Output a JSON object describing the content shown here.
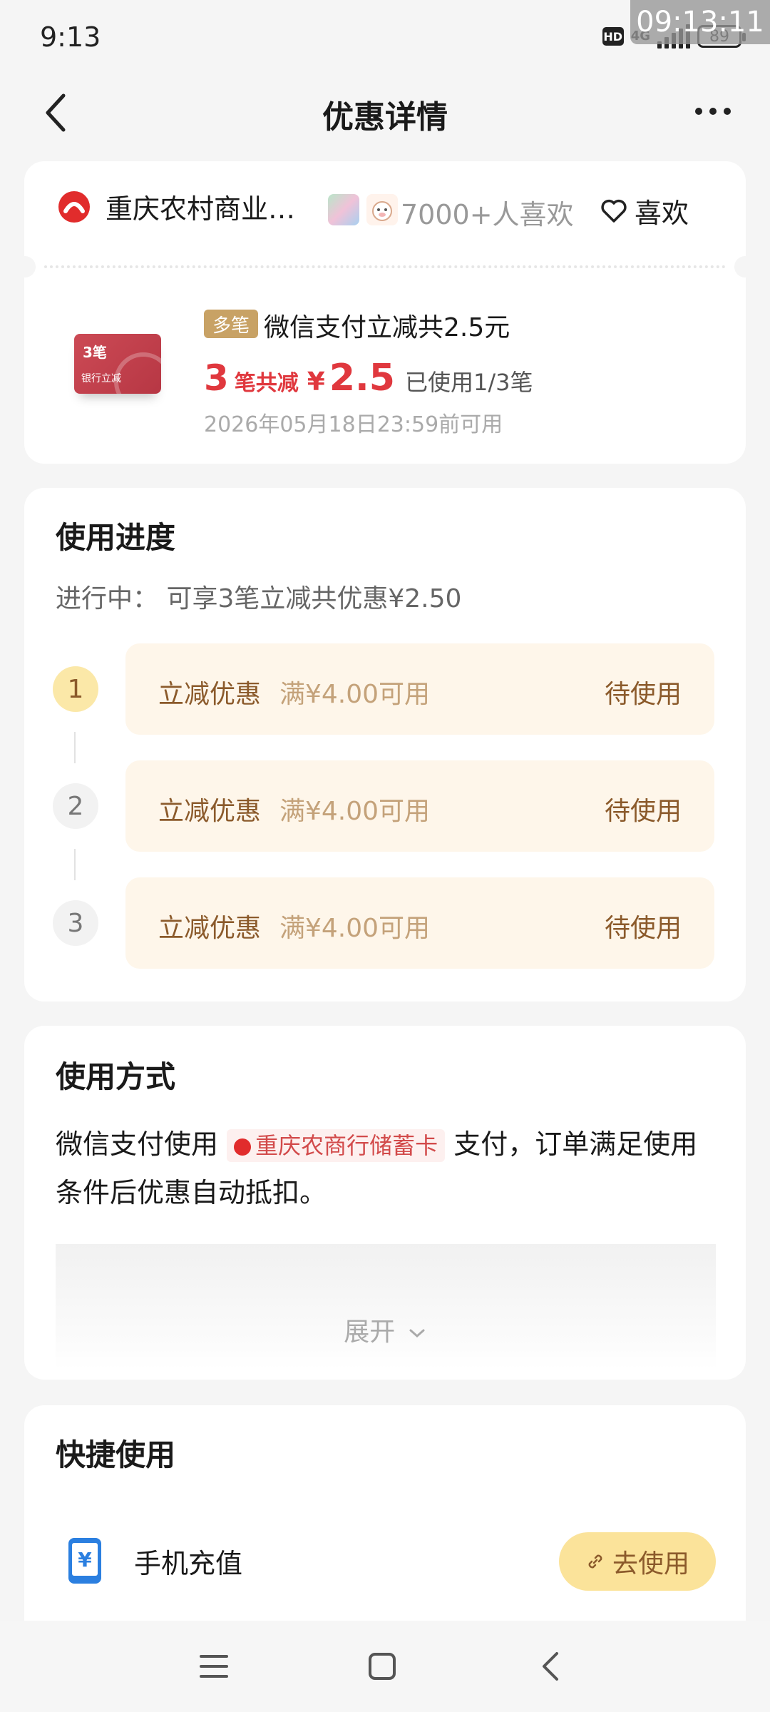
{
  "status_bar": {
    "time": "9:13",
    "hd_label": "HD",
    "network": "4G",
    "battery": "89",
    "overlay_clock": "09:13:11"
  },
  "nav": {
    "title": "优惠详情",
    "back_icon": "chevron-left-icon",
    "more_icon": "more-dots-icon"
  },
  "merchant": {
    "name": "重庆农村商业…",
    "like_count": "7000+人喜欢",
    "like_label": "喜欢"
  },
  "coupon": {
    "image_count_text": "3笔",
    "image_caption": "银行立减",
    "tag": "多笔",
    "title": "微信支付立减共2.5元",
    "count": "3",
    "count_suffix": "笔共减",
    "currency": "¥",
    "amount": "2.5",
    "used_text": "已使用1/3笔",
    "expire_text": "2026年05月18日23:59前可用"
  },
  "progress": {
    "title": "使用进度",
    "subtitle": "进行中：  可享3笔立减共优惠¥2.50",
    "steps": [
      {
        "num": "1",
        "label": "立减优惠",
        "condition": "满¥4.00可用",
        "status": "待使用"
      },
      {
        "num": "2",
        "label": "立减优惠",
        "condition": "满¥4.00可用",
        "status": "待使用"
      },
      {
        "num": "3",
        "label": "立减优惠",
        "condition": "满¥4.00可用",
        "status": "待使用"
      }
    ]
  },
  "usage": {
    "title": "使用方式",
    "text_before": "微信支付使用",
    "card_name": "重庆农商行储蓄卡",
    "text_after": "支付，订单满足使用条件后优惠自动抵扣。",
    "expand_label": "展开"
  },
  "quick": {
    "title": "快捷使用",
    "item_label": "手机充值",
    "button_label": "去使用"
  },
  "colors": {
    "accent_red": "#e0383e",
    "step_bg": "#fef6ea",
    "button_yellow": "#fbe39a",
    "tag_gold": "#c8a265"
  }
}
